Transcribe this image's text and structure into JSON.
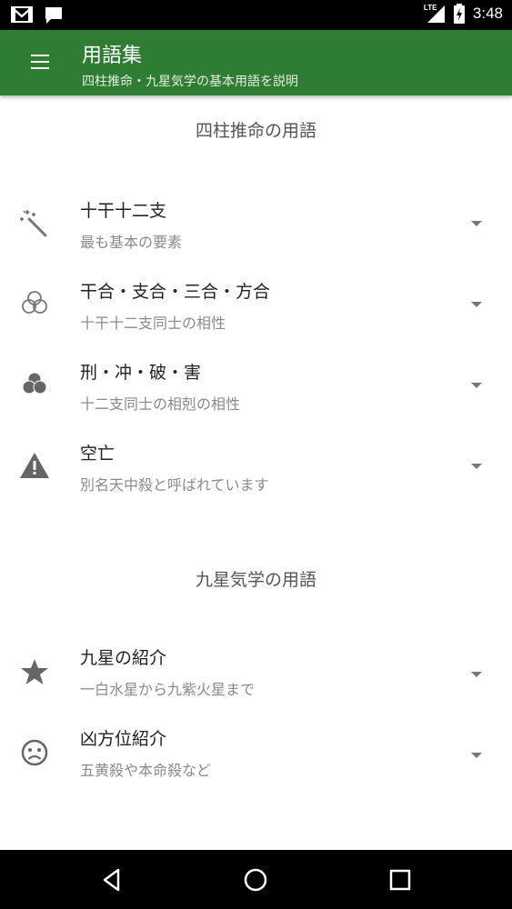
{
  "status_bar": {
    "time": "3:48",
    "network_label": "LTE",
    "icons": [
      "gmail-icon",
      "message-icon",
      "signal-icon",
      "battery-charging-icon"
    ]
  },
  "app_bar": {
    "title": "用語集",
    "subtitle": "四柱推命・九星気学の基本用語を説明",
    "menu_icon": "hamburger-menu-icon"
  },
  "sections": [
    {
      "header": "四柱推命の用語",
      "items": [
        {
          "title": "十干十二支",
          "subtitle": "最も基本の要素",
          "icon": "magic-wand-icon"
        },
        {
          "title": "干合・支合・三合・方合",
          "subtitle": "十干十二支同士の相性",
          "icon": "three-circles-outline-icon"
        },
        {
          "title": "刑・冲・破・害",
          "subtitle": "十二支同士の相剋の相性",
          "icon": "three-circles-filled-icon"
        },
        {
          "title": "空亡",
          "subtitle": "別名天中殺と呼ばれています",
          "icon": "warning-icon"
        }
      ]
    },
    {
      "header": "九星気学の用語",
      "items": [
        {
          "title": "九星の紹介",
          "subtitle": "一白水星から九紫火星まで",
          "icon": "star-icon"
        },
        {
          "title": "凶方位紹介",
          "subtitle": "五黄殺や本命殺など",
          "icon": "sad-face-icon"
        }
      ]
    }
  ],
  "nav_bar": {
    "buttons": [
      "back-icon",
      "home-icon",
      "recents-icon"
    ]
  },
  "colors": {
    "app_bar": "#2e7d32",
    "status_bar": "#000000",
    "icon_gray": "#777777"
  }
}
